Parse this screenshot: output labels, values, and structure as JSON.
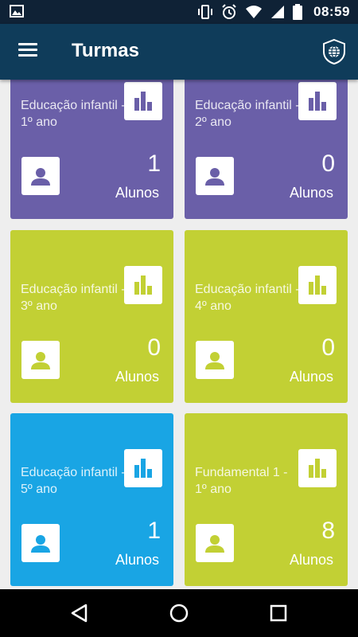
{
  "status_bar": {
    "time": "08:59",
    "left_icon": "image-icon",
    "right_icons": [
      "vibrate-icon",
      "alarm-icon",
      "wifi-icon",
      "signal-icon",
      "battery-icon"
    ]
  },
  "app_bar": {
    "title": "Turmas",
    "menu_icon": "hamburger-menu-icon",
    "action_icon": "shield-globe-icon"
  },
  "cards": [
    {
      "title": "Educação infantil - 1º ano",
      "count": "1",
      "label": "Alunos",
      "color": "#6a5fa8"
    },
    {
      "title": "Educação infantil - 2º ano",
      "count": "0",
      "label": "Alunos",
      "color": "#6a5fa8"
    },
    {
      "title": "Educação infantil - 3º ano",
      "count": "0",
      "label": "Alunos",
      "color": "#c2d034"
    },
    {
      "title": "Educação infantil - 4º ano",
      "count": "0",
      "label": "Alunos",
      "color": "#c2d034"
    },
    {
      "title": "Educação infantil - 5º ano",
      "count": "1",
      "label": "Alunos",
      "color": "#19a5e4"
    },
    {
      "title": "Fundamental 1 - 1º ano",
      "count": "8",
      "label": "Alunos",
      "color": "#c2d034"
    }
  ],
  "nav_bar": {
    "back_icon": "back-triangle-icon",
    "home_icon": "home-circle-icon",
    "recents_icon": "recents-square-icon"
  }
}
